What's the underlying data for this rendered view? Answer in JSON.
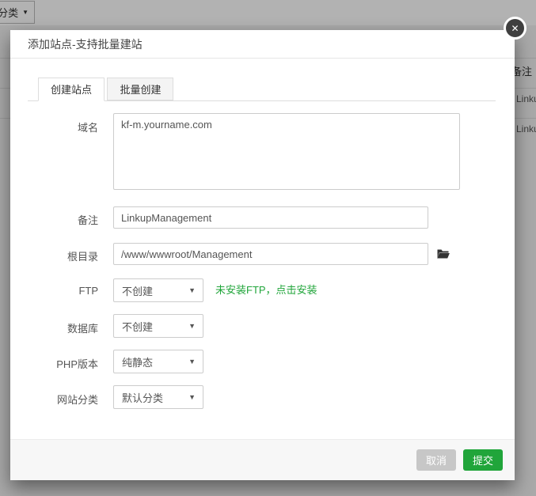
{
  "background": {
    "category_button": {
      "label": "分类"
    },
    "table": {
      "note_header": "备注",
      "rows": [
        "Linku",
        "Linku"
      ]
    }
  },
  "icons": {
    "caret_down": "▼",
    "close": "✕"
  },
  "modal": {
    "title": "添加站点-支持批量建站",
    "tabs": {
      "create": "创建站点",
      "batch": "批量创建"
    },
    "form": {
      "domain": {
        "label": "域名",
        "value": "kf-m.yourname.com"
      },
      "note": {
        "label": "备注",
        "value": "LinkupManagement"
      },
      "root_dir": {
        "label": "根目录",
        "value": "/www/wwwroot/Management"
      },
      "ftp": {
        "label": "FTP",
        "value": "不创建",
        "hint": "未安装FTP，点击安装"
      },
      "database": {
        "label": "数据库",
        "value": "不创建"
      },
      "php_version": {
        "label": "PHP版本",
        "value": "纯静态"
      },
      "site_category": {
        "label": "网站分类",
        "value": "默认分类"
      }
    },
    "footer": {
      "cancel": "取消",
      "submit": "提交"
    }
  },
  "colors": {
    "accent_green": "#20a53a",
    "cancel_gray": "#c7c7c7"
  }
}
